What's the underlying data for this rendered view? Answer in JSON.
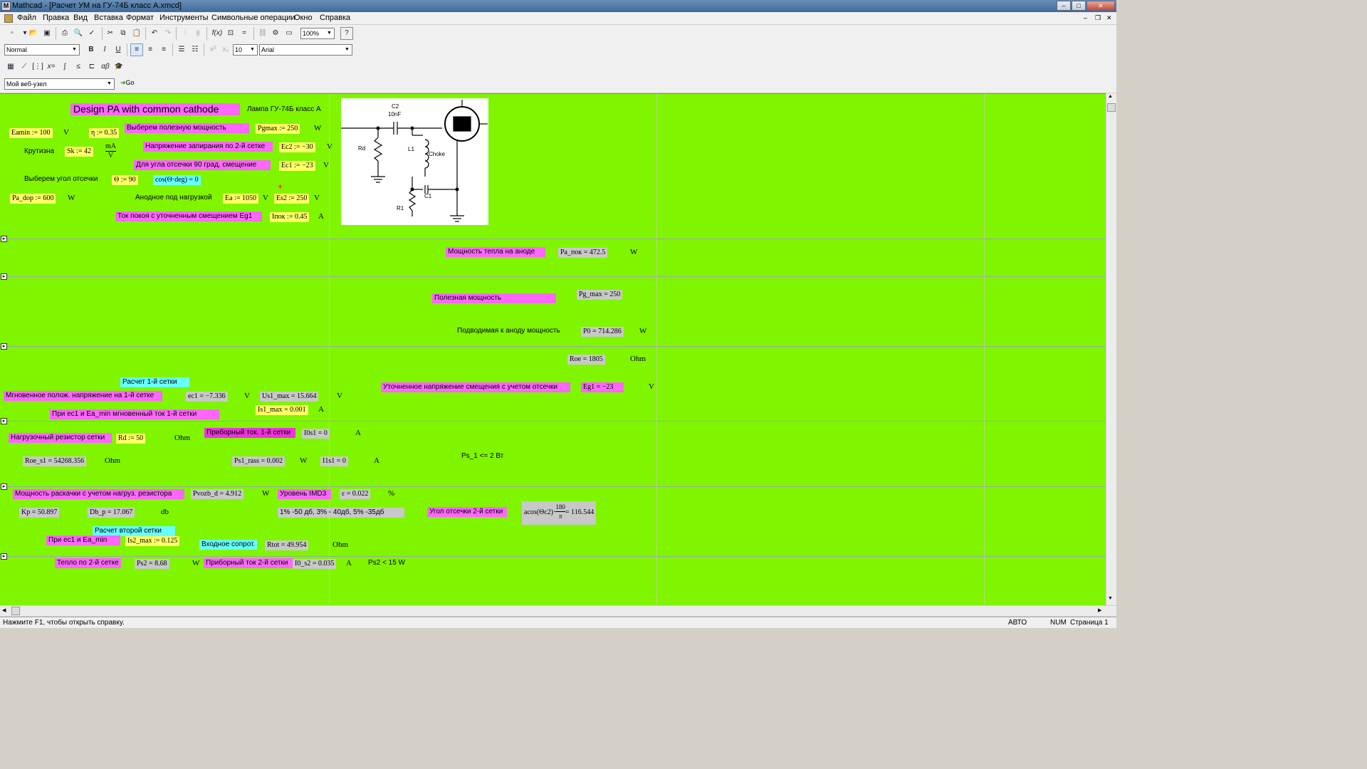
{
  "window": {
    "title": "Mathcad - [Расчет УМ на ГУ-74Б  класс А.xmcd]",
    "app_icon": "mathcad-icon"
  },
  "menu": [
    "Файл",
    "Правка",
    "Вид",
    "Вставка",
    "Формат",
    "Инструменты",
    "Символьные операции",
    "Окно",
    "Справка"
  ],
  "toolbar": {
    "zoom": "100%",
    "style": "Normal",
    "font_size": "10",
    "font": "Arial",
    "web_node": "Мой веб-узел",
    "go": "Go"
  },
  "header": {
    "title": "Design PA with common cathode",
    "lamp": "Лампа ГУ-74Б класс А"
  },
  "schematic": {
    "c2": "C2",
    "c2_val": "10nF",
    "rd": "Rd",
    "l1": "L1",
    "choke": "Choke",
    "r1": "R1",
    "c1": "C1"
  },
  "labels": {
    "useful_power": "Выберем полезную мощность",
    "krutizna": "Крутизна",
    "cutoff_voltage": "Напряжение запирания по 2-й сетке",
    "angle_bias": "Для угла отсечки 90 град. смещение",
    "angle_choose": "Выберем угол отсечки",
    "anode_load": "Анодное под нагрузкой",
    "quiescent": "Ток покоя с уточненным смещением Eg1",
    "heat_anode": "Мощность тепла на аноде",
    "useful_power2": "Полезная мощность",
    "input_anode_power": "Подводимая к аноду мощность",
    "grid1_calc": "Расчет 1-й сетки",
    "instant_voltage": "Мгновенное полож. напряжение на 1-й сетке",
    "refined_bias": "Уточненное напряжение смещения с учетом отсечки",
    "instant_current": "При ес1  и Ea_min мгновенный ток 1-й сетки",
    "load_resistor": "Нагрузочный резистор сетки",
    "meter_current1": "Приборный ток. 1-й сетки",
    "ps1_limit": "Ps_1 <= 2 Вт",
    "drive_power": "Мощность раскачки с учетом нагруз. резистора",
    "imd3": "Уровень IMD3",
    "imd3_note": "1% -50 дб, 3% - 40дб, 5% -35дб",
    "grid2_angle": "Угол отсечки 2-й сетки",
    "grid2_calc": "Расчет второй сетки",
    "at_ec1": "При ес1 и Ea_min",
    "input_res": "Входное сопрот.",
    "heat_grid2": "Тепло по 2-й сетке",
    "meter_current2": "Приборный ток 2-й сетки",
    "ps2_limit": "Ps2 < 15 W"
  },
  "math": {
    "eamin": "Eamin := 100",
    "eta": "η := 0.35",
    "pgmax": "Pgmax := 250",
    "sk": "Sk := 42",
    "ec2": "Ec2 := −30",
    "ec1": "Ec1 := −23",
    "theta": "Θ := 90",
    "cos": "cos(Θ·deg) = 0",
    "pa_dop": "Pa_dop := 600",
    "ea": "Ea := 1050",
    "es2": "Es2 := 250",
    "inok": "Iпок := 0.45",
    "pa_pok": "Pa_пок = 472.5",
    "pg_max": "Pg_max = 250",
    "p0": "P0 = 714.286",
    "roe": "Roe = 1805",
    "ec1v": "ec1 = −7.336",
    "us1": "Us1_max = 15.664",
    "eg1": "Eg1 = −23",
    "is1": "Is1_max = 0.001",
    "rd": "Rd := 50",
    "i0s1": "I0s1 = 0",
    "roe_s1": "Roe_s1 = 54268.356",
    "ps1": "Ps1_rass = 0.002",
    "i1s1": "I1s1 = 0",
    "pvozb": "Pvozb_d = 4.912",
    "eps": "ε = 0.022",
    "kp": "Kp = 50.897",
    "dbp": "Db_p = 17.067",
    "acos": "acos(Θc2)·",
    "acos_num": "180",
    "acos_den": "π",
    "acos_res": "= 116.544",
    "is2": "Is2_max := 0.125",
    "rtot": "Rtot = 49.954",
    "ps2": "Ps2 = 8.68",
    "i0s2": "I0_s2 = 0.035"
  },
  "units": {
    "V": "V",
    "W": "W",
    "A": "A",
    "Ohm": "Ohm",
    "db": "db",
    "pct": "%",
    "mA": "mA"
  },
  "status": {
    "hint": "Нажмите F1, чтобы открыть справку.",
    "auto": "АВТО",
    "num": "NUM",
    "page": "Страница 1"
  }
}
